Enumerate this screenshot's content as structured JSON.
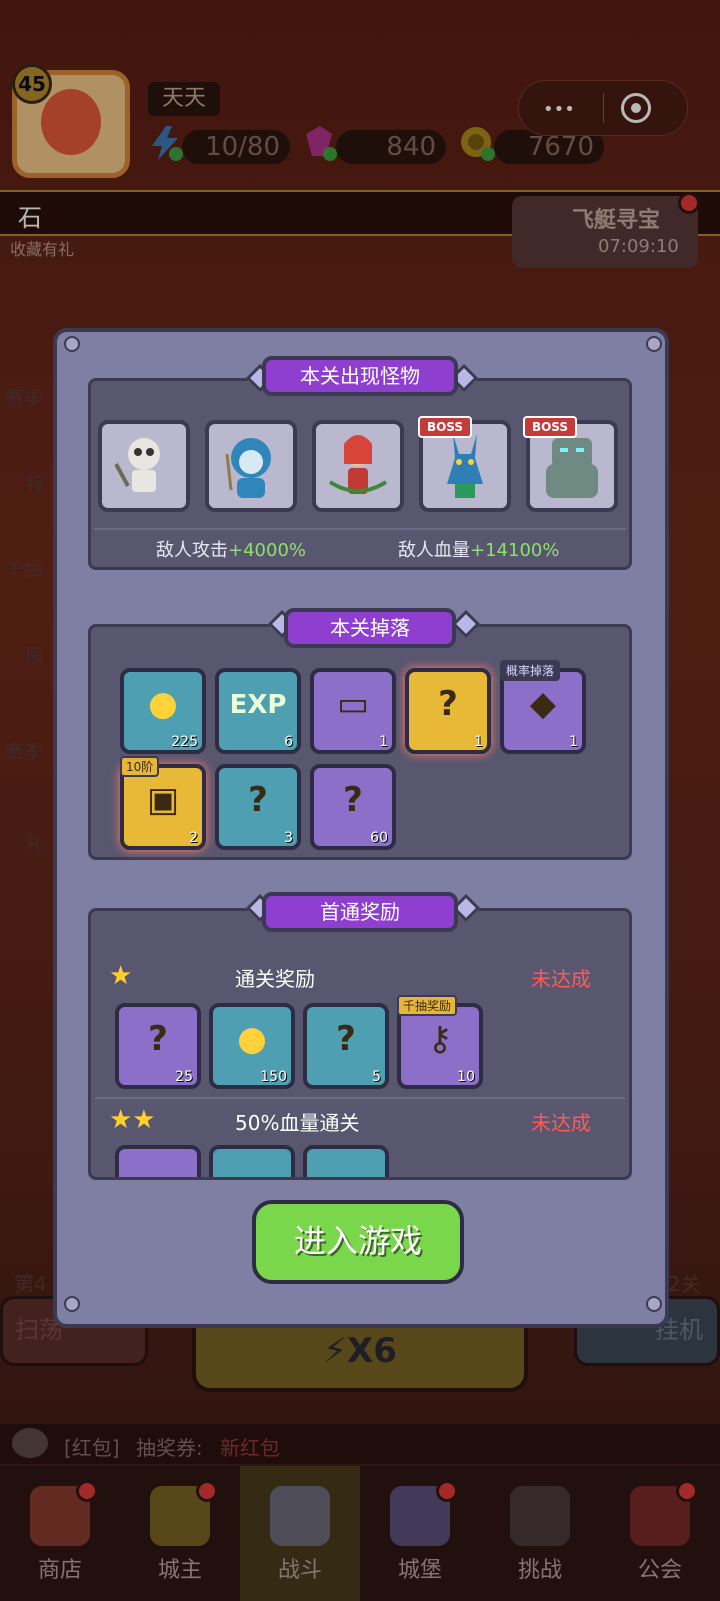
{
  "header": {
    "level": "45",
    "player_name": "天天",
    "energy": "10/80",
    "gems": "840",
    "gold": "7670"
  },
  "marquee": {
    "text": "石",
    "subtitle": "收藏有礼"
  },
  "event": {
    "title": "飞艇寻宝",
    "timer": "07:09:10"
  },
  "side_left": [
    "赛季",
    "特",
    "千抽",
    "限",
    "赛季",
    "礼"
  ],
  "monsters_section": {
    "title": "本关出现怪物",
    "monsters": [
      {
        "name": "skeleton-monster",
        "boss": false
      },
      {
        "name": "blue-mage-monster",
        "boss": false
      },
      {
        "name": "red-archer-monster",
        "boss": false
      },
      {
        "name": "dragon-monster",
        "boss": true
      },
      {
        "name": "golem-monster",
        "boss": true
      }
    ],
    "boss_label": "BOSS",
    "enemy_attack_label": "敌人攻击",
    "enemy_attack_value": "+4000%",
    "enemy_hp_label": "敌人血量",
    "enemy_hp_value": "+14100%"
  },
  "drops_section": {
    "title": "本关掉落",
    "items": [
      {
        "icon": "gold-coin-icon",
        "count": "225",
        "style": "teal",
        "glyph": "●",
        "tag": ""
      },
      {
        "icon": "exp-icon",
        "count": "6",
        "style": "teal",
        "glyph": "EXP",
        "tag": ""
      },
      {
        "icon": "ticket-icon",
        "count": "1",
        "style": "purple",
        "glyph": "▭",
        "tag": ""
      },
      {
        "icon": "random-gems-icon",
        "count": "1",
        "style": "gold",
        "glyph": "?",
        "tag": ""
      },
      {
        "icon": "fire-crystal-icon",
        "count": "1",
        "style": "purple",
        "glyph": "◆",
        "tag": "概率掉落"
      },
      {
        "icon": "treasure-chest-icon",
        "count": "2",
        "style": "gold",
        "glyph": "▣",
        "tag": "10阶"
      },
      {
        "icon": "mystery-banner-icon",
        "count": "3",
        "style": "teal",
        "glyph": "?",
        "tag": ""
      },
      {
        "icon": "mystery-puzzle-icon",
        "count": "60",
        "style": "purple",
        "glyph": "?",
        "tag": ""
      }
    ]
  },
  "first_clear_section": {
    "title": "首通奖励",
    "rows": [
      {
        "stars": "★",
        "label": "通关奖励",
        "status": "未达成",
        "rewards": [
          {
            "icon": "mystery-puzzle-icon",
            "count": "25",
            "style": "purple",
            "glyph": "?",
            "tag": ""
          },
          {
            "icon": "gold-coin-icon",
            "count": "150",
            "style": "teal",
            "glyph": "●",
            "tag": ""
          },
          {
            "icon": "mystery-banner-icon",
            "count": "5",
            "style": "teal",
            "glyph": "?",
            "tag": ""
          },
          {
            "icon": "gold-key-icon",
            "count": "10",
            "style": "purple",
            "glyph": "⚷",
            "tag": "千抽奖励"
          }
        ]
      },
      {
        "stars": "★★",
        "label": "50%血量通关",
        "status": "未达成"
      }
    ]
  },
  "enter_button": "进入游戏",
  "behind": {
    "stage_left": "第4",
    "stage_right": "2关",
    "sweep": "扫荡",
    "x6": "X6",
    "afk": "挂机",
    "chat_tag": "[红包]",
    "chat_text": "抽奖券:",
    "chat_highlight": "新红包"
  },
  "nav": [
    {
      "label": "商店",
      "icon": "shop-icon"
    },
    {
      "label": "城主",
      "icon": "crown-icon"
    },
    {
      "label": "战斗",
      "icon": "swords-icon"
    },
    {
      "label": "城堡",
      "icon": "castle-icon"
    },
    {
      "label": "挑战",
      "icon": "demon-icon"
    },
    {
      "label": "公会",
      "icon": "guild-icon"
    }
  ],
  "colors": {
    "dialog_bg": "#7f7ea3",
    "banner_purple": "#8f3fcf",
    "green_value": "#8ee06d",
    "red_status": "#ff5a5a",
    "enter_green": "#7ad64a"
  }
}
